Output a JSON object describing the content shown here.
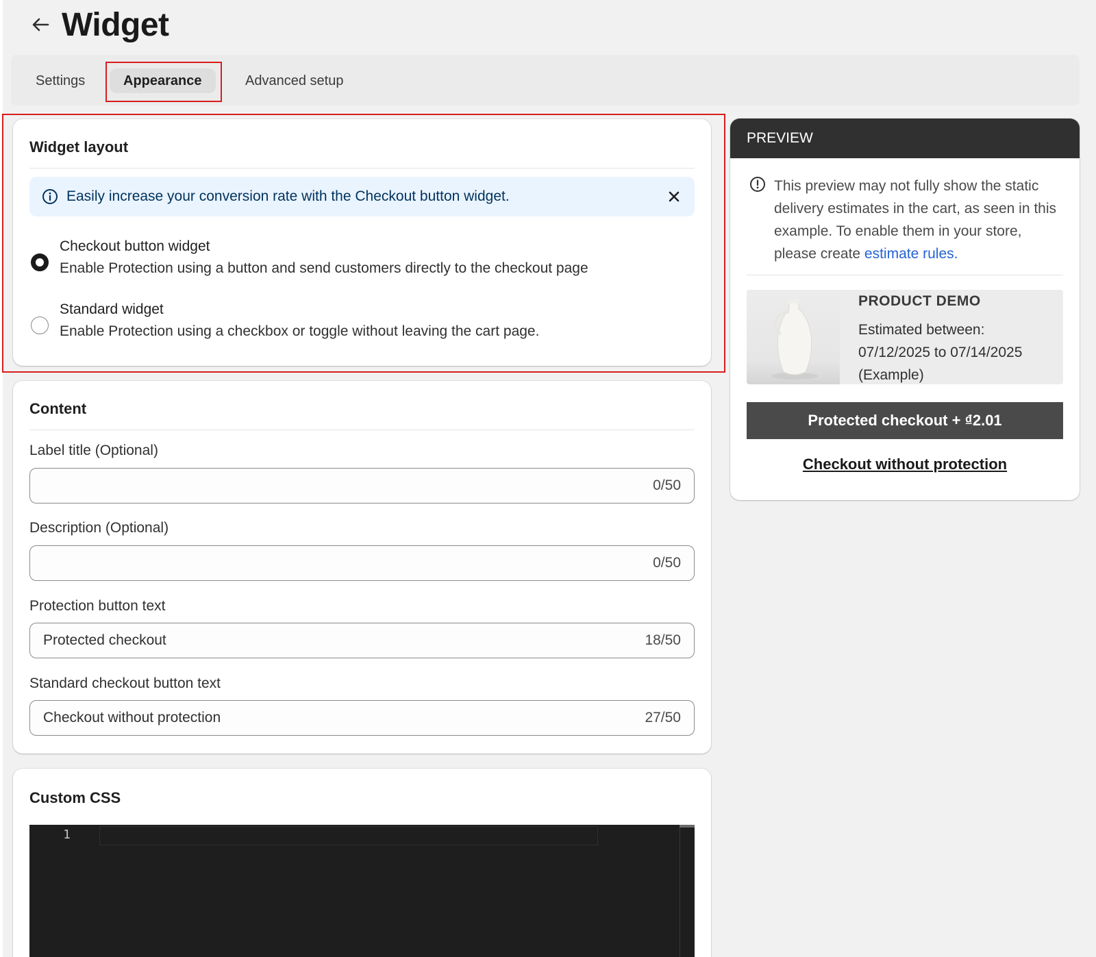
{
  "page": {
    "title": "Widget"
  },
  "tabs": [
    {
      "label": "Settings",
      "active": false
    },
    {
      "label": "Appearance",
      "active": true
    },
    {
      "label": "Advanced setup",
      "active": false
    }
  ],
  "widget_layout": {
    "title": "Widget layout",
    "banner": "Easily increase your conversion rate with the Checkout button widget.",
    "options": [
      {
        "label": "Checkout button widget",
        "help": "Enable Protection using a button and send customers directly to the checkout page",
        "selected": true
      },
      {
        "label": "Standard widget",
        "help": "Enable Protection using a checkbox or toggle without leaving the cart page.",
        "selected": false
      }
    ]
  },
  "content": {
    "title": "Content",
    "fields": [
      {
        "label": "Label title (Optional)",
        "value": "",
        "count": "0/50"
      },
      {
        "label": "Description (Optional)",
        "value": "",
        "count": "0/50"
      },
      {
        "label": "Protection button text",
        "value": "Protected checkout",
        "count": "18/50"
      },
      {
        "label": "Standard checkout button text",
        "value": "Checkout without protection",
        "count": "27/50"
      }
    ]
  },
  "custom_css": {
    "title": "Custom CSS",
    "line_number": "1"
  },
  "preview": {
    "header": "PREVIEW",
    "note": "This preview may not fully show the static delivery estimates in the cart, as seen in this example. To enable them in your store, please create ",
    "note_link": "estimate rules.",
    "product_name": "PRODUCT DEMO",
    "estimate": "Estimated between: 07/12/2025 to 07/14/2025 (Example)",
    "protected_button": "Protected checkout + ₫2.01",
    "unprotected_link": "Checkout without protection"
  },
  "colors": {
    "highlight": "#d91c1c",
    "banner_bg": "#eaf4ff",
    "link": "#2463d3",
    "preview_header": "#303030"
  }
}
